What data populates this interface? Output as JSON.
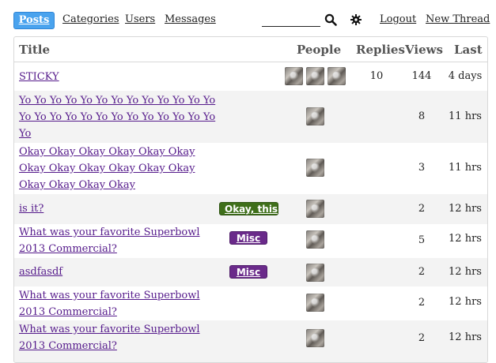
{
  "nav": {
    "posts": "Posts",
    "categories": "Categories",
    "users": "Users",
    "messages": "Messages",
    "search_value": "",
    "logout": "Logout",
    "new_thread": "New Thread"
  },
  "table": {
    "headers": {
      "title": "Title",
      "people": "People",
      "replies": "Replies",
      "views": "Views",
      "last": "Last"
    },
    "rows": [
      {
        "title": "STICKY",
        "category": "",
        "replies": "10",
        "views": "144",
        "last": "4 days"
      },
      {
        "title": "Yo Yo Yo Yo Yo Yo Yo Yo Yo Yo Yo Yo Yo Yo Yo Yo Yo Yo Yo Yo Yo Yo Yo Yo Yo Yo Yo",
        "category": "",
        "replies": "",
        "views": "8",
        "last": "11 hrs"
      },
      {
        "title": "Okay Okay Okay Okay Okay Okay Okay Okay Okay Okay Okay Okay Okay Okay Okay Okay",
        "category": "",
        "replies": "",
        "views": "3",
        "last": "11 hrs"
      },
      {
        "title": "is it?",
        "category": "Okay, this",
        "replies": "2",
        "views": "",
        "last": "12 hrs"
      },
      {
        "title": "What was your favorite Superbowl 2013 Commercial?",
        "category": "Misc",
        "replies": "5",
        "views": "",
        "last": "12 hrs"
      },
      {
        "title": "asdfasdf",
        "category": "Misc",
        "replies": "2",
        "views": "",
        "last": "12 hrs"
      },
      {
        "title": "What was your favorite Superbowl 2013 Commercial?",
        "category": "",
        "replies": "2",
        "views": "",
        "last": "12 hrs"
      },
      {
        "title": "What was your favorite Superbowl 2013 Commercial?",
        "category": "",
        "replies": "2",
        "views": "",
        "last": "12 hrs"
      }
    ]
  },
  "colors": {
    "nav_active": "#4aa3ee",
    "link": "#551a8b",
    "badge_green": "#3f6f1a",
    "badge_purple": "#6a2a8a"
  }
}
